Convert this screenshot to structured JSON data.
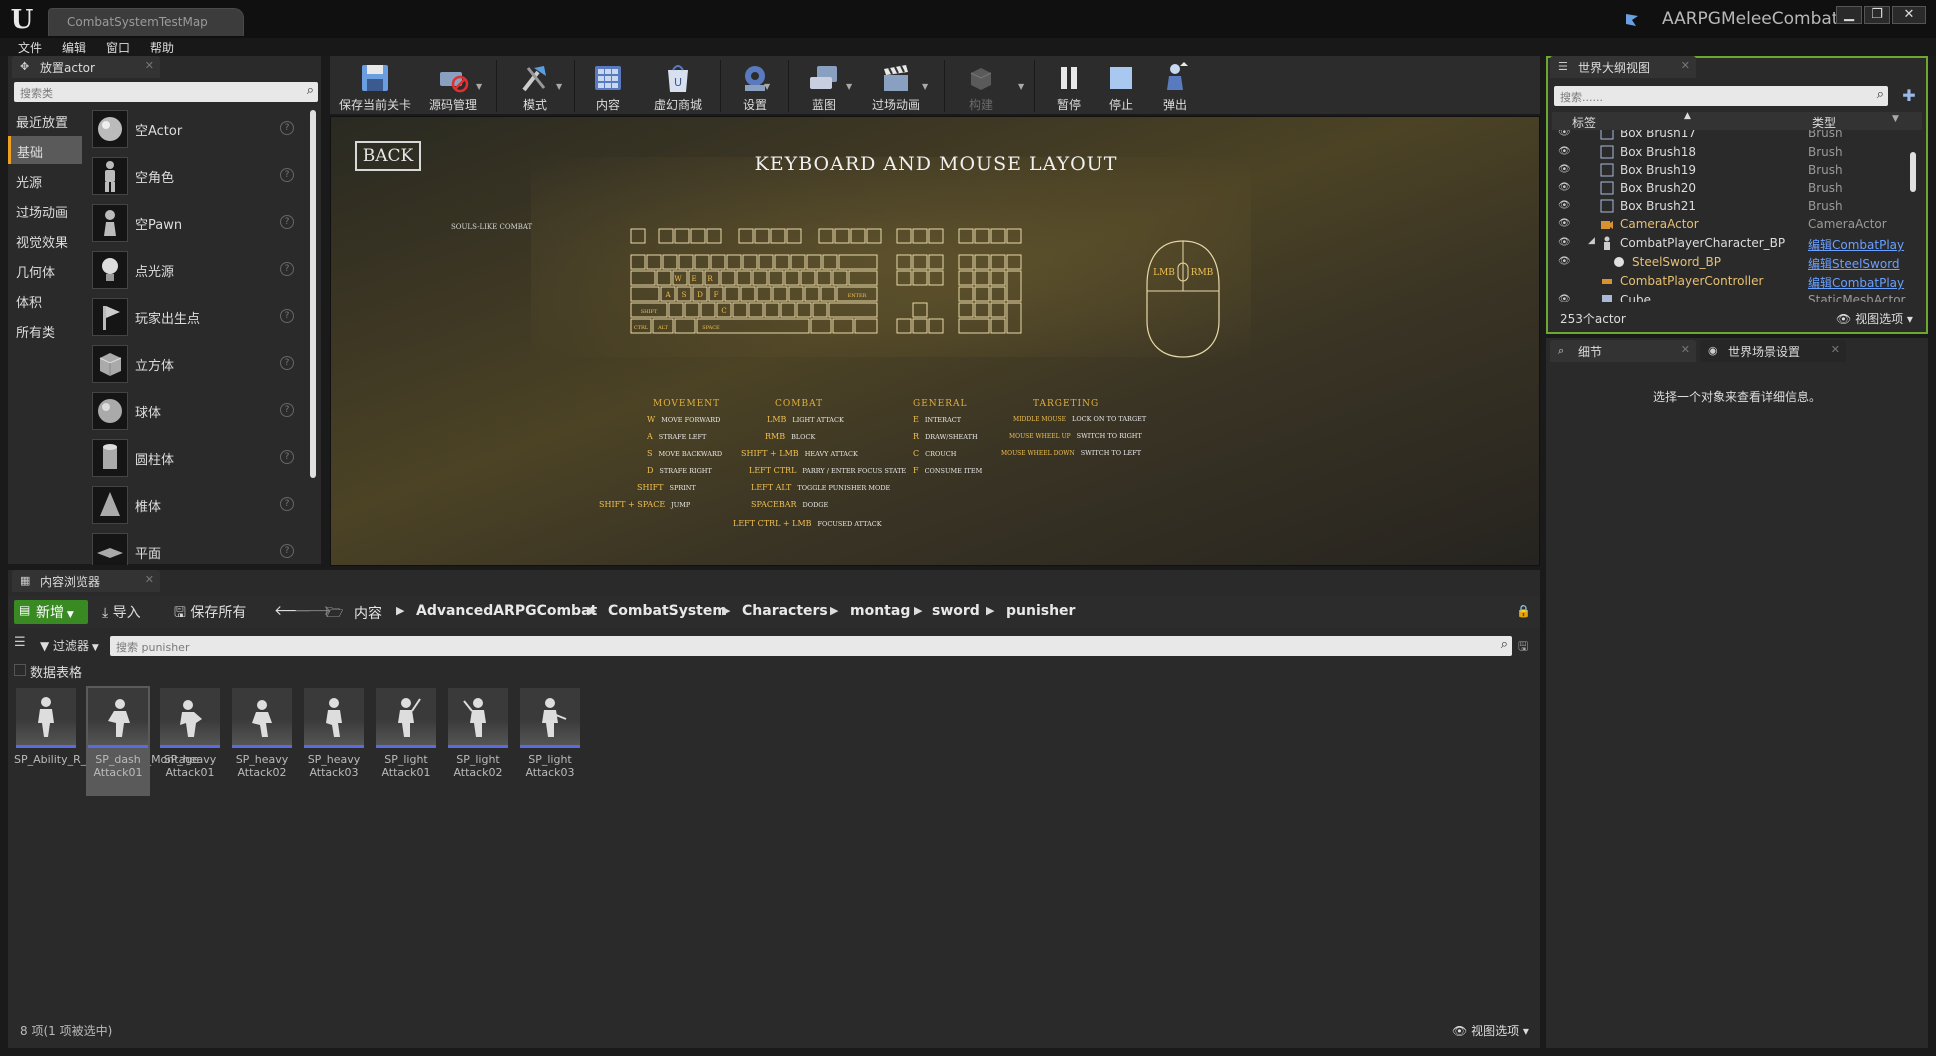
{
  "window": {
    "map_tab": "CombatSystemTestMap",
    "project_name": "AARPGMeleeCombat",
    "min": "▁",
    "max": "❐",
    "close": "✕"
  },
  "menu": [
    "文件",
    "编辑",
    "窗口",
    "帮助"
  ],
  "place_actors": {
    "tab_label": "放置actor",
    "search_placeholder": "搜索类",
    "categories": [
      "最近放置",
      "基础",
      "光源",
      "过场动画",
      "视觉效果",
      "几何体",
      "体积",
      "所有类"
    ],
    "active_category": "基础",
    "items": [
      {
        "label": "空Actor",
        "icon": "sphere-icon"
      },
      {
        "label": "空角色",
        "icon": "mannequin-icon"
      },
      {
        "label": "空Pawn",
        "icon": "pawn-icon"
      },
      {
        "label": "点光源",
        "icon": "bulb-icon"
      },
      {
        "label": "玩家出生点",
        "icon": "flag-icon"
      },
      {
        "label": "立方体",
        "icon": "cube-icon"
      },
      {
        "label": "球体",
        "icon": "sphere-icon"
      },
      {
        "label": "圆柱体",
        "icon": "cylinder-icon"
      },
      {
        "label": "椎体",
        "icon": "cone-icon"
      },
      {
        "label": "平面",
        "icon": "plane-icon"
      }
    ]
  },
  "toolbar": {
    "save": "保存当前关卡",
    "source": "源码管理",
    "modes": "模式",
    "content": "内容",
    "marketplace": "虚幻商城",
    "settings": "设置",
    "blueprints": "蓝图",
    "cinematics": "过场动画",
    "build": "构建",
    "pause": "暂停",
    "stop": "停止",
    "eject": "弹出"
  },
  "viewport": {
    "back": "BACK",
    "title": "KEYBOARD AND MOUSE LAYOUT",
    "subtitle": "SOULS-LIKE COMBAT",
    "mouse_left": "LMB",
    "mouse_right": "RMB",
    "kb_keys": {
      "w": "W",
      "e": "E",
      "r": "R",
      "a": "A",
      "s": "S",
      "d": "D",
      "f": "F",
      "c": "C",
      "shift": "SHIFT",
      "enter": "ENTER",
      "ctrl": "CTRL",
      "alt": "ALT",
      "space": "SPACE"
    },
    "legend": {
      "movement": {
        "head": "MOVEMENT",
        "rows": [
          [
            "W",
            "MOVE FORWARD"
          ],
          [
            "A",
            "STRAFE LEFT"
          ],
          [
            "S",
            "MOVE BACKWARD"
          ],
          [
            "D",
            "STRAFE RIGHT"
          ],
          [
            "SHIFT",
            "SPRINT"
          ],
          [
            "SHIFT + SPACE",
            "JUMP"
          ]
        ]
      },
      "combat": {
        "head": "COMBAT",
        "rows": [
          [
            "LMB",
            "LIGHT ATTACK"
          ],
          [
            "RMB",
            "BLOCK"
          ],
          [
            "SHIFT + LMB",
            "HEAVY ATTACK"
          ],
          [
            "LEFT CTRL",
            "PARRY / ENTER FOCUS STATE"
          ],
          [
            "LEFT ALT",
            "TOGGLE PUNISHER MODE"
          ],
          [
            "SPACEBAR",
            "DODGE"
          ],
          [
            "LEFT CTRL + LMB",
            "FOCUSED ATTACK"
          ]
        ]
      },
      "general": {
        "head": "GENERAL",
        "rows": [
          [
            "E",
            "INTERACT"
          ],
          [
            "R",
            "DRAW/SHEATH"
          ],
          [
            "C",
            "CROUCH"
          ],
          [
            "F",
            "CONSUME ITEM"
          ]
        ]
      },
      "targeting": {
        "head": "TARGETING",
        "rows": [
          [
            "MIDDLE MOUSE",
            "LOCK ON TO TARGET"
          ],
          [
            "MOUSE WHEEL UP",
            "SWITCH TO RIGHT"
          ],
          [
            "MOUSE WHEEL DOWN",
            "SWITCH TO LEFT"
          ]
        ]
      }
    }
  },
  "outliner": {
    "tab_label": "世界大纲视图",
    "search_placeholder": "搜索......",
    "col_label": "标签",
    "col_type": "类型",
    "rows": [
      {
        "name": "Box Brush17",
        "type": "Brush",
        "link": false
      },
      {
        "name": "Box Brush18",
        "type": "Brush",
        "link": false
      },
      {
        "name": "Box Brush19",
        "type": "Brush",
        "link": false
      },
      {
        "name": "Box Brush20",
        "type": "Brush",
        "link": false
      },
      {
        "name": "Box Brush21",
        "type": "Brush",
        "link": false
      },
      {
        "name": "CameraActor",
        "type": "CameraActor",
        "link": false
      },
      {
        "name": "CombatPlayerCharacter_BP",
        "type": "编辑CombatPlay",
        "link": true
      },
      {
        "name": "SteelSword_BP",
        "type": "编辑SteelSword",
        "link": true
      },
      {
        "name": "CombatPlayerController",
        "type": "编辑CombatPlay",
        "link": true
      },
      {
        "name": "Cube",
        "type": "StaticMeshActor",
        "link": false
      }
    ],
    "count": "253个actor",
    "view_options": "视图选项"
  },
  "details": {
    "tab_label": "细节",
    "world_settings_tab": "世界场景设置",
    "empty_message": "选择一个对象来查看详细信息。"
  },
  "content_browser": {
    "tab_label": "内容浏览器",
    "new": "新增",
    "import": "导入",
    "save_all": "保存所有",
    "path": [
      "内容",
      "AdvancedARPGCombat",
      "CombatSystem",
      "Characters",
      "montag",
      "sword",
      "punisher"
    ],
    "filters": "过滤器",
    "search_placeholder": "搜索 punisher",
    "data_table": "数据表格",
    "assets": [
      {
        "label": "SP_Ability_R_Intro_Anim_Montage",
        "selected": false
      },
      {
        "label": "SP_dash Attack01",
        "selected": true
      },
      {
        "label": "SP_heavy Attack01",
        "selected": false
      },
      {
        "label": "SP_heavy Attack02",
        "selected": false
      },
      {
        "label": "SP_heavy Attack03",
        "selected": false
      },
      {
        "label": "SP_light Attack01",
        "selected": false
      },
      {
        "label": "SP_light Attack02",
        "selected": false
      },
      {
        "label": "SP_light Attack03",
        "selected": false
      }
    ],
    "status": "8 项(1 项被选中)",
    "view_options": "视图选项"
  },
  "colors": {
    "accent_green": "#3a8a24",
    "outliner_border": "#6aa832",
    "selection_orange": "#f0a020",
    "link_blue": "#6aa0ff"
  }
}
